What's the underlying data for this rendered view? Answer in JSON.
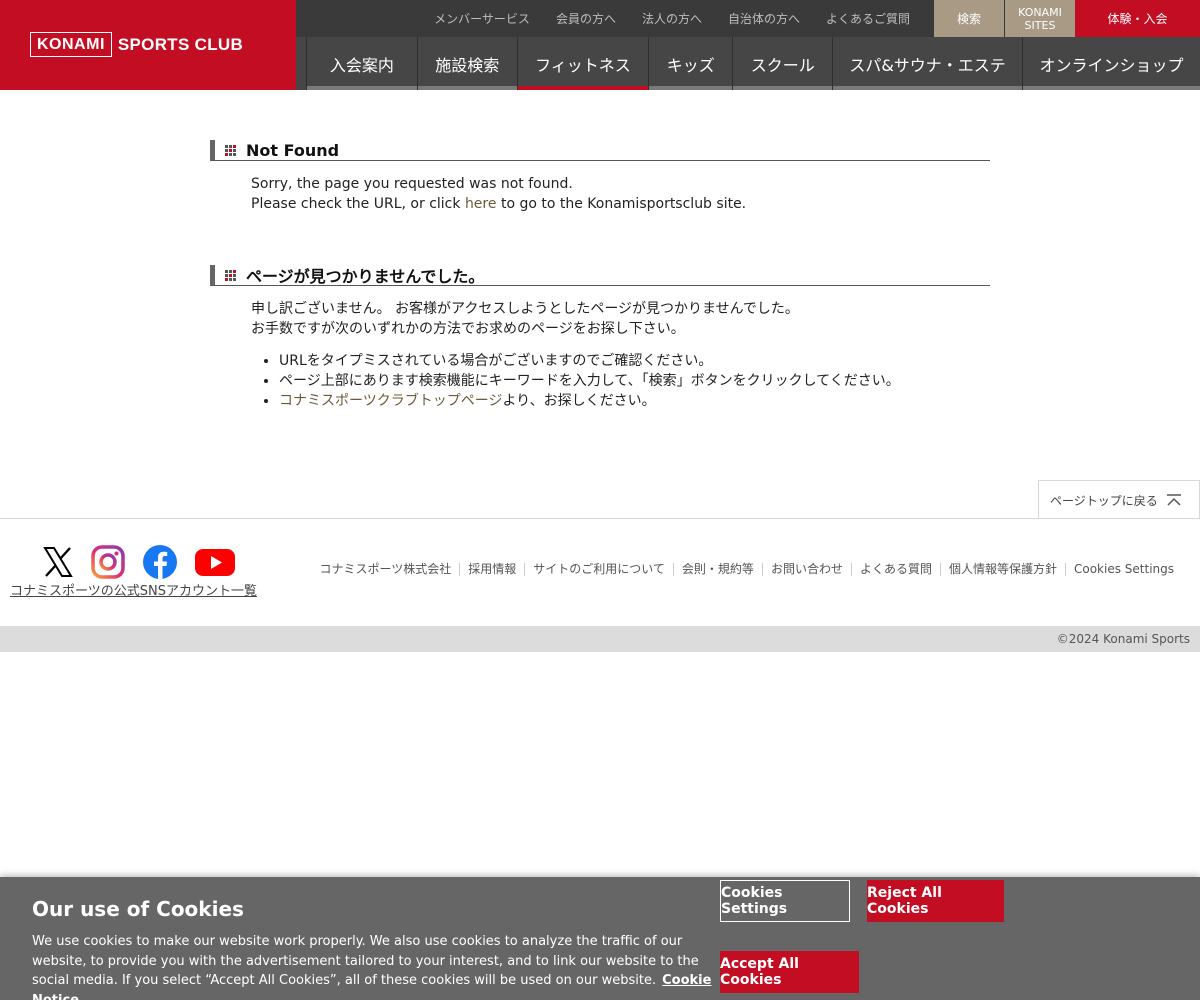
{
  "header": {
    "logo": {
      "box_text": "KONAMI",
      "text": "SPORTS CLUB"
    },
    "util_links": [
      "メンバーサービス",
      "会員の方へ",
      "法人の方へ",
      "自治体の方へ",
      "よくあるご質問"
    ],
    "search_label": "検索",
    "sites_label_1": "KONAMI",
    "sites_label_2": "SITES",
    "trial_label": "体験・入会",
    "nav": [
      {
        "label": "入会案内"
      },
      {
        "label": "施設検索"
      },
      {
        "label": "フィットネス",
        "active": true
      },
      {
        "label": "キッズ"
      },
      {
        "label": "スクール"
      },
      {
        "label": "スパ&サウナ・エステ"
      },
      {
        "label": "オンラインショップ"
      }
    ]
  },
  "not_found": {
    "title": "Not Found",
    "line1": "Sorry, the page you requested was not found.",
    "line2_pre": "Please check the URL, or click ",
    "line2_link": "here",
    "line2_post": " to go to the Konamisportsclub site."
  },
  "jp_section": {
    "title": "ページが見つかりませんでした。",
    "line1": "申し訳ございません。 お客様がアクセスしようとしたページが見つかりませんでした。",
    "line2": "お手数ですが次のいずれかの方法でお求めのページをお探し下さい。",
    "bullet1": "URLをタイプミスされている場合がございますのでご確認ください。",
    "bullet2": "ページ上部にあります検索機能にキーワードを入力して、「検索」ボタンをクリックしてください。",
    "bullet3_link": "コナミスポーツクラブトップページ",
    "bullet3_post": "より、お探しください。"
  },
  "back_to_top": "ページトップに戻る",
  "footer": {
    "sns_link": "コナミスポーツの公式SNSアカウント一覧",
    "links": [
      "コナミスポーツ株式会社",
      "採用情報",
      "サイトのご利用について",
      "会則・規約等",
      "お問い合わせ",
      "よくある質問",
      "個人情報等保護方針",
      "Cookies Settings"
    ],
    "copyright": "©2024 Konami Sports"
  },
  "cookie": {
    "title": "Our use of Cookies",
    "text": "We use cookies to make our website work properly. We also use cookies to analyze the traffic of our website, to provide you with the advertisement tailored to your interest, and to link our website to the social media. If you select “Accept All Cookies”, all of these cookies will be used on our website.",
    "notice_link": "Cookie Notice",
    "settings_label": "Cookies Settings",
    "reject_label": "Reject All Cookies",
    "accept_label": "Accept All Cookies"
  },
  "colors": {
    "brand_red": "#c30d23",
    "nav_bg": "#464646",
    "topbar_bg": "#3a3a3a",
    "utility_tan": "#a89a84",
    "cookie_bg": "#666666"
  }
}
